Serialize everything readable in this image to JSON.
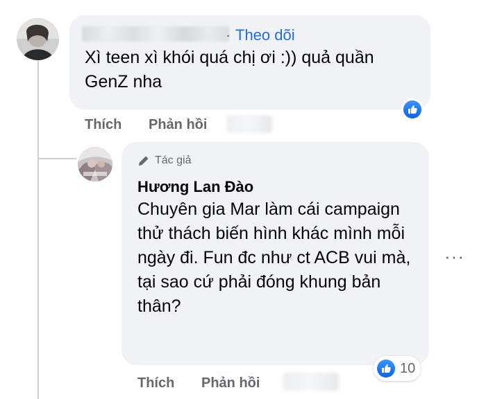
{
  "comment": {
    "follow_label": "Theo dõi",
    "follow_separator": "·",
    "text": "Xì teen xì khói quá chị ơi :)) quả quần GenZ nha",
    "actions": {
      "like": "Thích",
      "reply": "Phản hồi"
    },
    "reaction": "like"
  },
  "reply": {
    "author_tag": "Tác giả",
    "author_name": "Hương Lan Đào",
    "text": "Chuyên gia Mar làm cái campaign thử thách biến hình khác mình mỗi ngày đi. Fun đc như ct ACB vui mà, tại sao cứ phải đóng khung bản thân?",
    "reaction": "like",
    "reaction_count": "10",
    "actions": {
      "like": "Thích",
      "reply": "Phản hồi"
    },
    "more_label": "···"
  },
  "colors": {
    "bubble": "#f0f2f5",
    "link": "#216fdb",
    "secondary_text": "#65676b",
    "like_blue": "#1877f2"
  }
}
